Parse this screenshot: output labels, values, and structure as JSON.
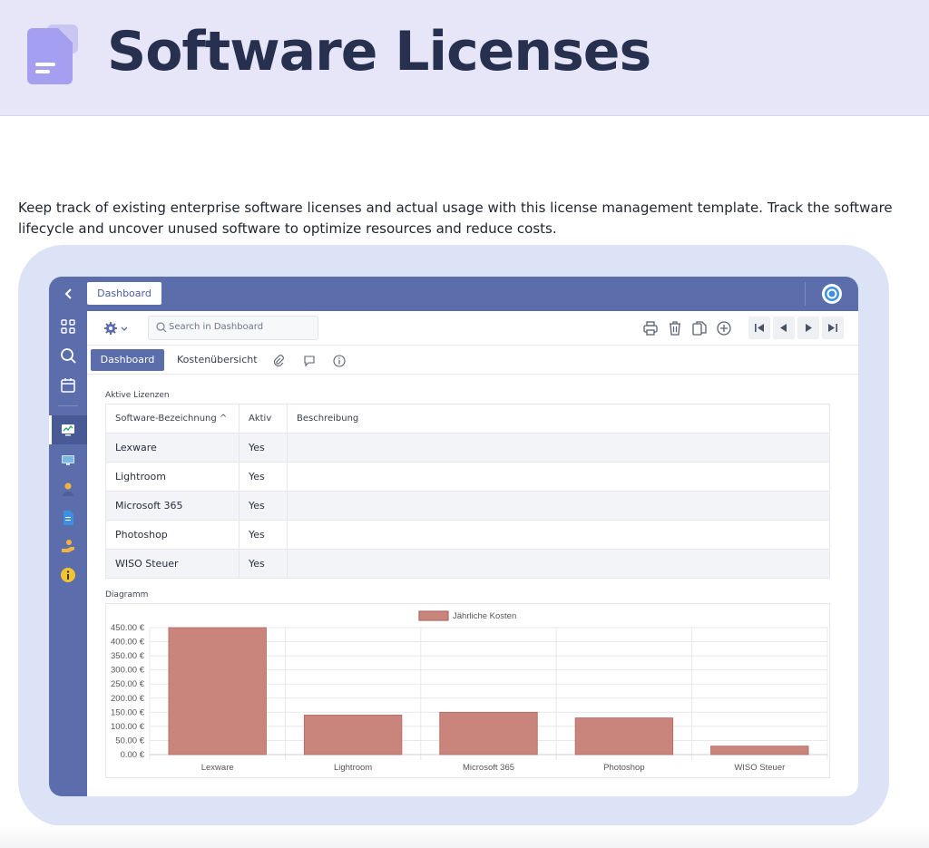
{
  "hero": {
    "title": "Software Licenses",
    "description": "Keep track of existing enterprise software licenses and actual usage with this license management template. Track the software lifecycle and uncover unused software to optimize resources and reduce costs."
  },
  "app": {
    "topbar": {
      "tab_label": "Dashboard",
      "back_icon": "chevron-left-icon",
      "logo_icon": "target-logo-icon"
    },
    "sidebar": {
      "icons": [
        "grid-icon",
        "search-icon",
        "calendar-icon",
        "monitor-chart-icon",
        "computer-icon",
        "person-icon",
        "document-icon",
        "hand-coin-icon",
        "info-icon"
      ]
    },
    "toolbar": {
      "search_placeholder": "Search in Dashboard",
      "icons": [
        "print-icon",
        "trash-icon",
        "copy-icon",
        "add-circle-icon",
        "first-page-icon",
        "prev-icon",
        "next-icon",
        "last-page-icon"
      ]
    },
    "tabs": {
      "dashboard": "Dashboard",
      "costs": "Kostenübersicht",
      "icons": [
        "paperclip-icon",
        "comment-icon",
        "info-icon"
      ]
    },
    "active_section_label": "Aktive Lizenzen",
    "table": {
      "headers": [
        "Software-Bezeichnung",
        "Aktiv",
        "Beschreibung"
      ],
      "sort_indicator": "^",
      "rows": [
        {
          "name": "Lexware",
          "active": "Yes",
          "description": ""
        },
        {
          "name": "Lightroom",
          "active": "Yes",
          "description": ""
        },
        {
          "name": "Microsoft 365",
          "active": "Yes",
          "description": ""
        },
        {
          "name": "Photoshop",
          "active": "Yes",
          "description": ""
        },
        {
          "name": "WISO Steuer",
          "active": "Yes",
          "description": ""
        }
      ]
    },
    "chart_section_label": "Diagramm"
  },
  "colors": {
    "accent": "#5b6eab",
    "bar": "#c9847c",
    "bar_border": "#b06a62"
  },
  "chart_data": {
    "type": "bar",
    "categories": [
      "Lexware",
      "Lightroom",
      "Microsoft 365",
      "Photoshop",
      "WISO Steuer"
    ],
    "series": [
      {
        "name": "Jährliche Kosten",
        "values": [
          450,
          140,
          150,
          130,
          30
        ]
      }
    ],
    "y_ticks": [
      "0.00 €",
      "50.00 €",
      "100.00 €",
      "150.00 €",
      "200.00 €",
      "250.00 €",
      "300.00 €",
      "350.00 €",
      "400.00 €",
      "450.00 €"
    ],
    "ylim": [
      0,
      450
    ],
    "legend": "top-center",
    "grid": true
  }
}
